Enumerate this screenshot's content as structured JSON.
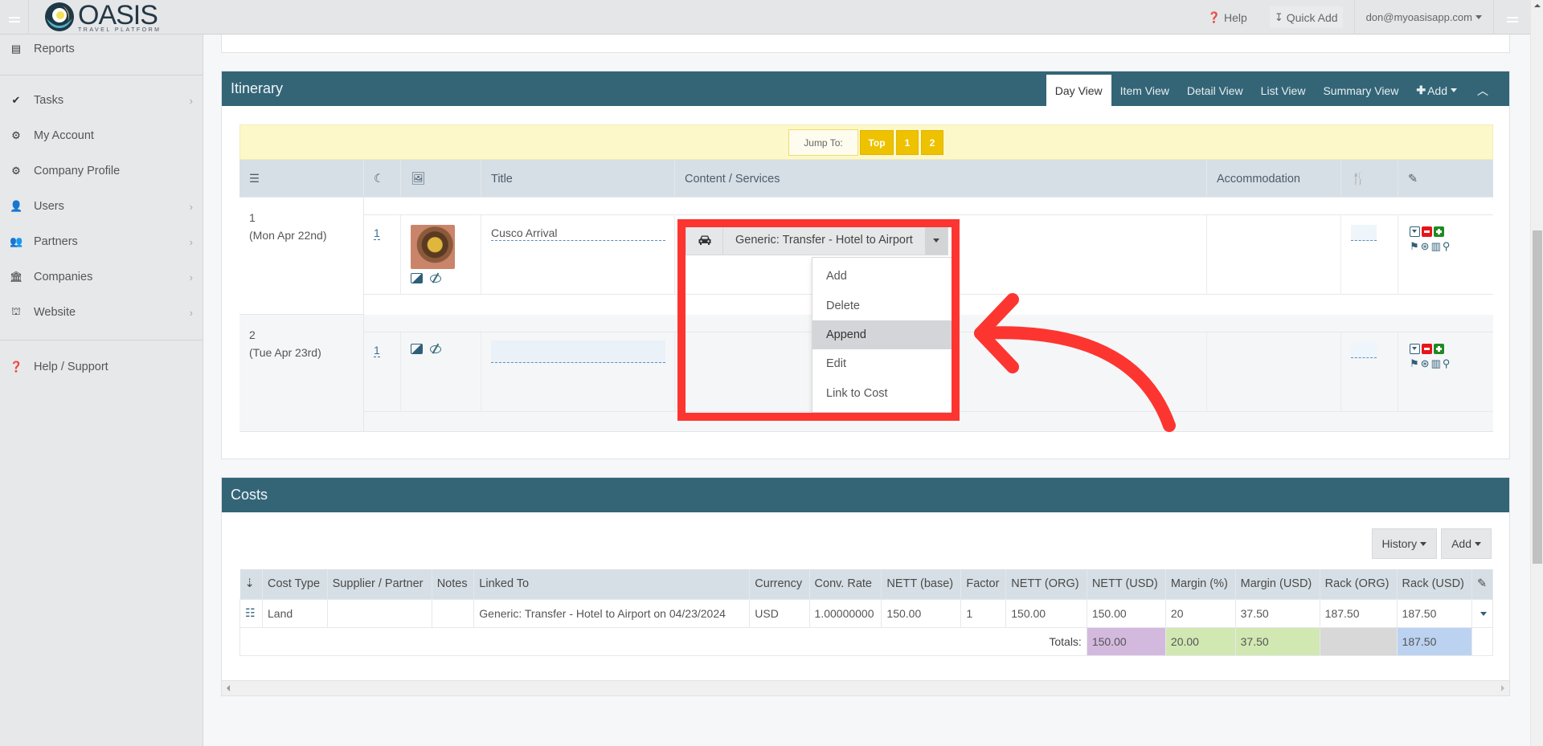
{
  "navbar": {
    "logo_name": "OASIS",
    "logo_sub": "TRAVEL PLATFORM",
    "help_label": "Help",
    "quick_add_label": "Quick Add",
    "user_email": "don@myoasisapp.com"
  },
  "sidebar": {
    "items": [
      {
        "label": "Reports",
        "icon": "report-icon",
        "has_children": false
      },
      {
        "label": "Tasks",
        "icon": "check-icon",
        "has_children": true
      },
      {
        "label": "My Account",
        "icon": "gear-icon",
        "has_children": false
      },
      {
        "label": "Company Profile",
        "icon": "gears-icon",
        "has_children": false
      },
      {
        "label": "Users",
        "icon": "user-icon",
        "has_children": true
      },
      {
        "label": "Partners",
        "icon": "users-icon",
        "has_children": true
      },
      {
        "label": "Companies",
        "icon": "bank-icon",
        "has_children": true
      },
      {
        "label": "Website",
        "icon": "sitemap-icon",
        "has_children": true
      },
      {
        "label": "Help / Support",
        "icon": "question-circle-icon",
        "has_children": false
      }
    ]
  },
  "itinerary": {
    "title": "Itinerary",
    "tabs": [
      "Day View",
      "Item View",
      "Detail View",
      "List View",
      "Summary View"
    ],
    "active_tab": "Day View",
    "add_label": "Add",
    "jump_to_label": "Jump To:",
    "jump_buttons": [
      "Top",
      "1",
      "2"
    ],
    "columns": [
      "Title",
      "Content / Services",
      "Accommodation"
    ],
    "days": [
      {
        "number": "1",
        "date": "(Mon Apr 22nd)",
        "nights": "1",
        "title": "Cusco Arrival",
        "has_image": true
      },
      {
        "number": "2",
        "date": "(Tue Apr 23rd)",
        "nights": "1",
        "title": "",
        "has_image": false
      }
    ],
    "service_label": "Generic: Transfer - Hotel to Airport",
    "service_menu": [
      "Add",
      "Delete",
      "Append",
      "Edit",
      "Link to Cost"
    ],
    "service_menu_highlighted": "Append"
  },
  "costs": {
    "title": "Costs",
    "history_label": "History",
    "add_label": "Add",
    "columns": [
      "Cost Type",
      "Supplier / Partner",
      "Notes",
      "Linked To",
      "Currency",
      "Conv. Rate",
      "NETT (base)",
      "Factor",
      "NETT (ORG)",
      "NETT (USD)",
      "Margin (%)",
      "Margin (USD)",
      "Rack (ORG)",
      "Rack (USD)"
    ],
    "rows": [
      {
        "cost_type": "Land",
        "supplier": "",
        "notes": "",
        "linked_to": "Generic: Transfer - Hotel to Airport on 04/23/2024",
        "currency": "USD",
        "conv_rate": "1.00000000",
        "nett_base": "150.00",
        "factor": "1",
        "nett_org": "150.00",
        "nett_usd": "150.00",
        "margin_pct": "20",
        "margin_usd": "37.50",
        "rack_org": "187.50",
        "rack_usd": "187.50"
      }
    ],
    "totals_label": "Totals:",
    "totals": {
      "nett_usd": "150.00",
      "margin_pct": "20.00",
      "margin_usd": "37.50",
      "rack_org": "",
      "rack_usd": "187.50"
    }
  },
  "colors": {
    "panel_header": "#336577",
    "jump_button": "#eec200",
    "highlight_annotation": "#fd3530"
  }
}
